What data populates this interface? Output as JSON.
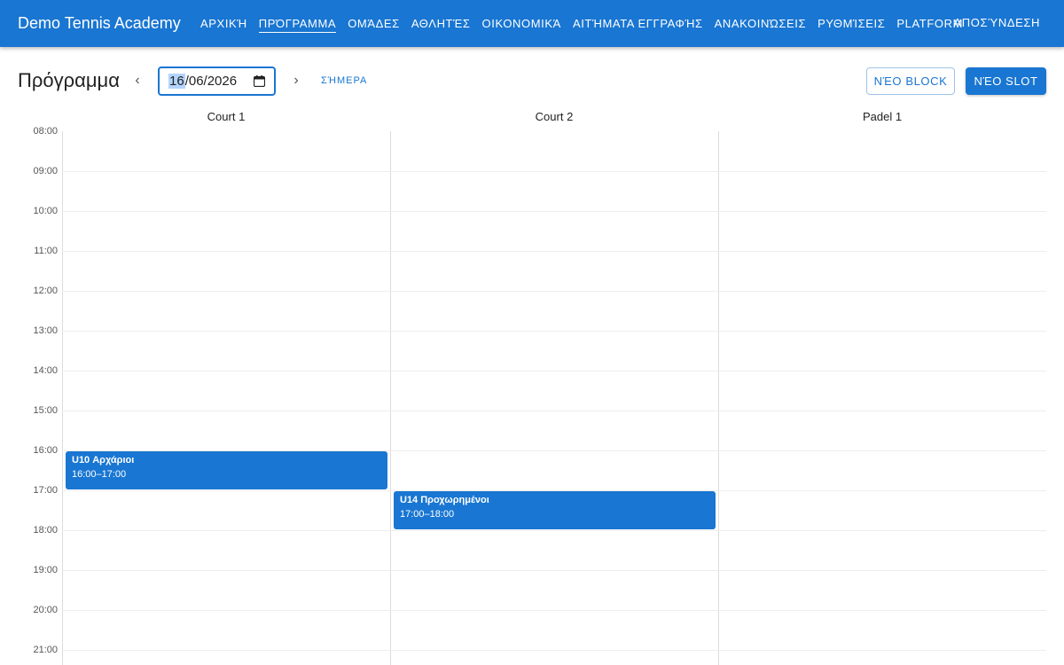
{
  "appbar": {
    "brand": "Demo Tennis Academy",
    "nav": [
      "ΑΡΧΙΚΉ",
      "ΠΡΌΓΡΑΜΜΑ",
      "ΟΜΆΔΕΣ",
      "ΑΘΛΗΤΈΣ",
      "ΟΙΚΟΝΟΜΙΚΆ",
      "ΑΙΤΉΜΑΤΑ ΕΓΓΡΑΦΉΣ",
      "ΑΝΑΚΟΙΝΏΣΕΙΣ",
      "ΡΥΘΜΊΣΕΙΣ",
      "PLATFORM"
    ],
    "active_index": 1,
    "logout": "ΑΠΟΣΎΝΔΕΣΗ"
  },
  "toolbar": {
    "title": "Πρόγραμμα",
    "prev": "‹",
    "next": "›",
    "date_day": "16",
    "date_rest": "/06/2026",
    "today": "ΣΉΜΕΡΑ",
    "new_block": "ΝΈΟ BLOCK",
    "new_slot": "ΝΈΟ SLOT"
  },
  "schedule": {
    "courts": [
      "Court 1",
      "Court 2",
      "Padel 1"
    ],
    "hours": [
      "08:00",
      "09:00",
      "10:00",
      "11:00",
      "12:00",
      "13:00",
      "14:00",
      "15:00",
      "16:00",
      "17:00",
      "18:00",
      "19:00",
      "20:00",
      "21:00"
    ],
    "events": [
      {
        "court": 0,
        "title": "U10 Αρχάριοι",
        "time": "16:00–17:00",
        "start": 16,
        "end": 17
      },
      {
        "court": 1,
        "title": "U14 Προχωρημένοι",
        "time": "17:00–18:00",
        "start": 17,
        "end": 18
      }
    ]
  },
  "colors": {
    "primary": "#1976d2"
  }
}
